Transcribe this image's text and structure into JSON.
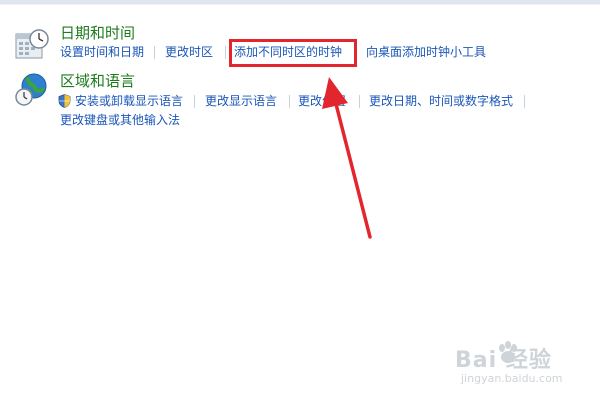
{
  "categories": [
    {
      "title": "日期和时间",
      "icon": "calendar-clock-icon",
      "tasks": [
        "设置时间和日期",
        "更改时区",
        "添加不同时区的时钟",
        "向桌面添加时钟小工具"
      ]
    },
    {
      "title": "区域和语言",
      "icon": "globe-clock-icon",
      "tasks": [
        "安装或卸载显示语言",
        "更改显示语言",
        "更改位置",
        "更改日期、时间或数字格式",
        "更改键盘或其他输入法"
      ]
    }
  ],
  "highlighted_task": "添加不同时区的时钟",
  "annotation": {
    "color": "#e3262e",
    "type": "red-box-and-arrow"
  },
  "watermark": {
    "brand": "Bai 经验",
    "url": "jingyan.baidu.com"
  },
  "colors": {
    "category_title": "#1e7b1e",
    "link": "#1a56b8",
    "annotation": "#e3262e"
  }
}
